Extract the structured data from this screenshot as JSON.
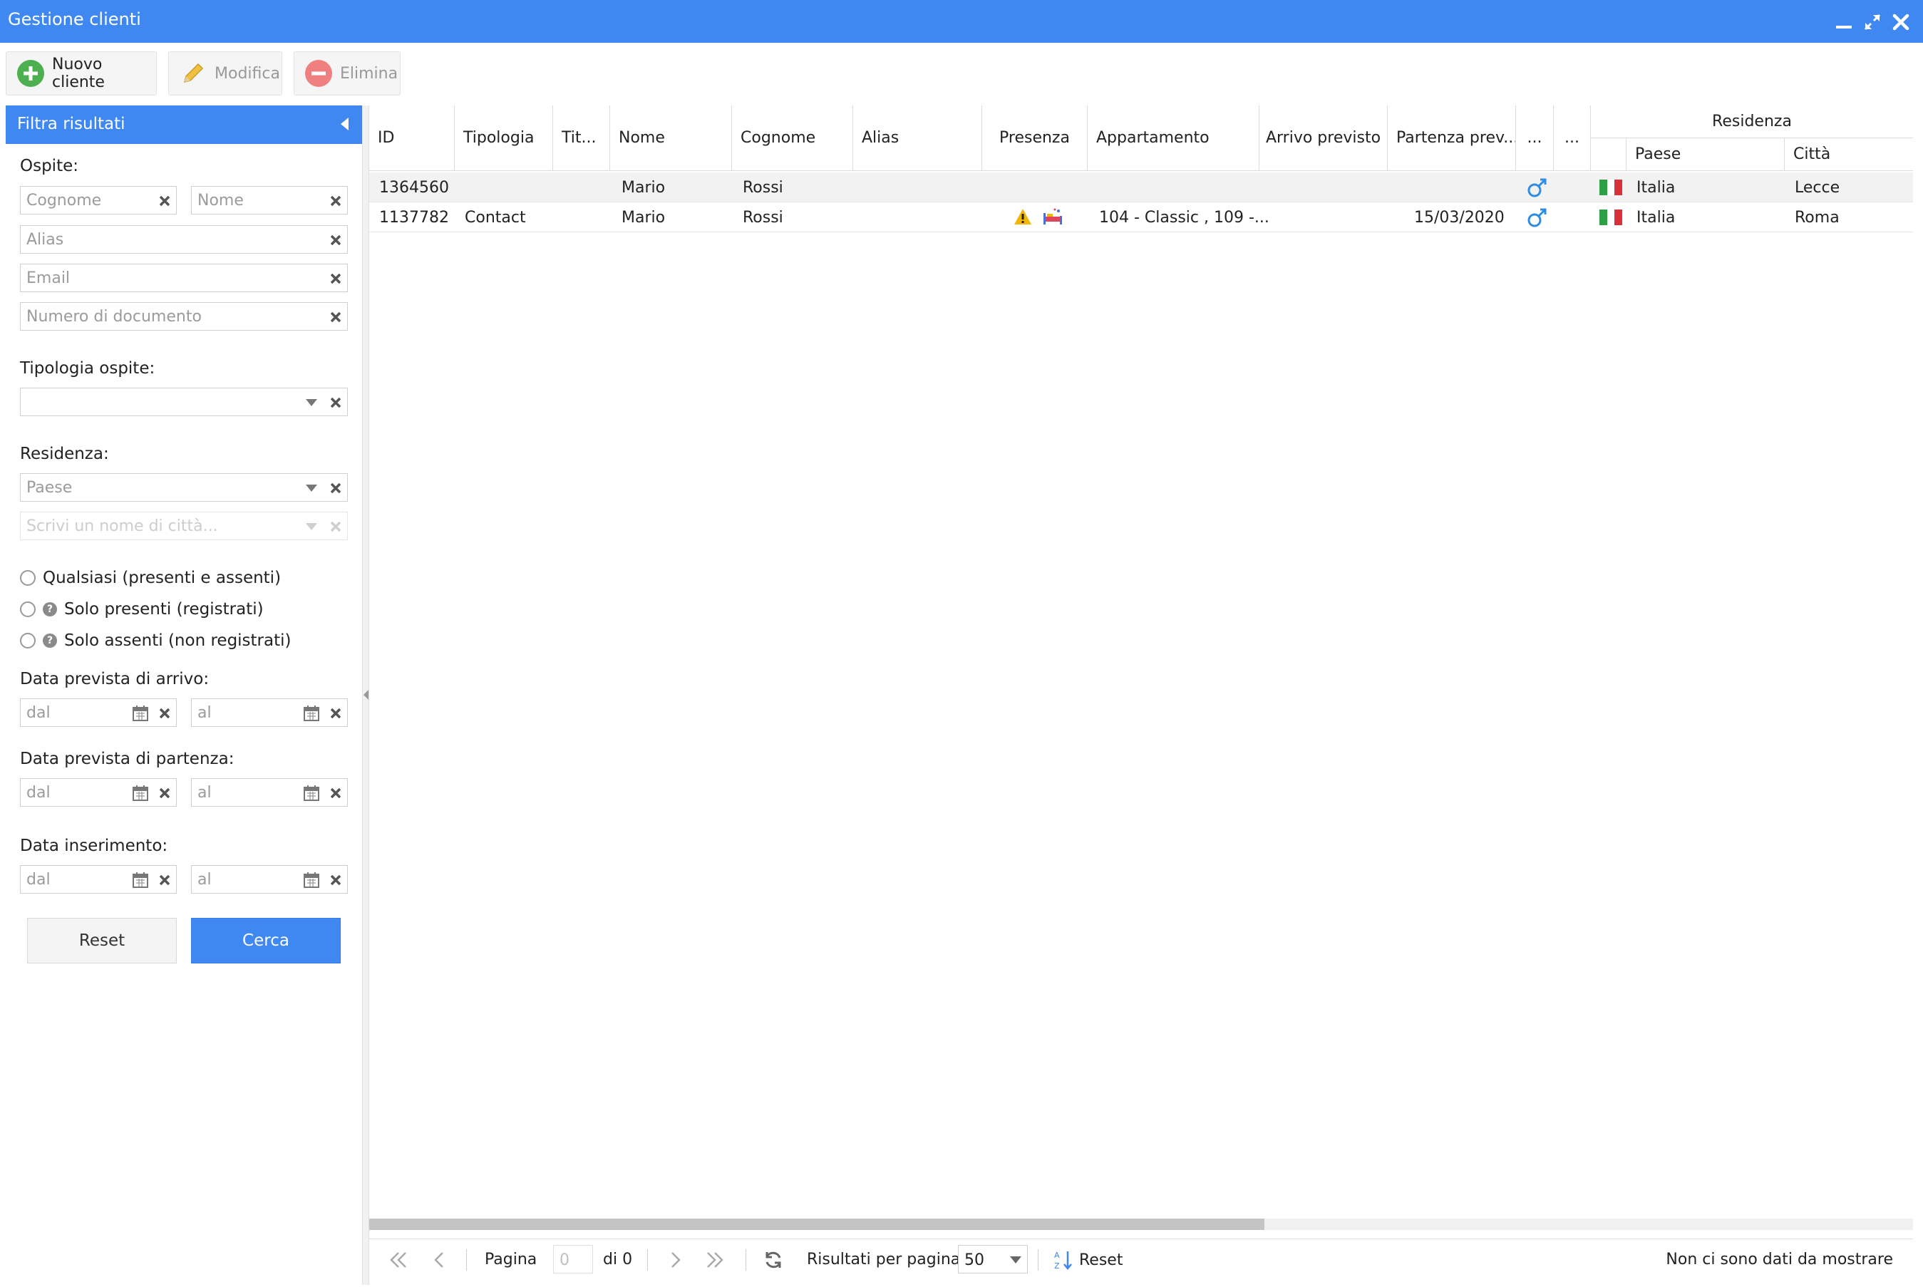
{
  "window": {
    "title": "Gestione clienti"
  },
  "toolbar": {
    "new_label": "Nuovo cliente",
    "edit_label": "Modifica",
    "delete_label": "Elimina"
  },
  "filter": {
    "header": "Filtra risultati",
    "guest_label": "Ospite:",
    "surname_placeholder": "Cognome",
    "name_placeholder": "Nome",
    "alias_placeholder": "Alias",
    "email_placeholder": "Email",
    "document_placeholder": "Numero di documento",
    "type_label": "Tipologia ospite:",
    "residence_label": "Residenza:",
    "country_placeholder": "Paese",
    "city_placeholder": "Scrivi un nome di città...",
    "presence_options": [
      "Qualsiasi (presenti e assenti)",
      "Solo presenti (registrati)",
      "Solo assenti (non registrati)"
    ],
    "help_glyph": "?",
    "arrival_label": "Data prevista di arrivo:",
    "departure_label": "Data prevista di partenza:",
    "insertion_label": "Data inserimento:",
    "from_placeholder": "dal",
    "to_placeholder": "al",
    "reset_label": "Reset",
    "search_label": "Cerca"
  },
  "grid": {
    "columns": {
      "id": "ID",
      "type": "Tipologia",
      "title": "Tit...",
      "name": "Nome",
      "surname": "Cognome",
      "alias": "Alias",
      "presence": "Presenza",
      "apartment": "Appartamento",
      "arrival": "Arrivo previsto",
      "departure": "Partenza prev...",
      "more1": "...",
      "more2": "...",
      "residence": "Residenza",
      "country": "Paese",
      "city": "Città"
    },
    "rows": [
      {
        "id": "1364560",
        "type": "",
        "name": "Mario",
        "surname": "Rossi",
        "apartment": "",
        "departure": "",
        "gender_icon": "male-icon",
        "flag": "italy",
        "country": "Italia",
        "city": "Lecce"
      },
      {
        "id": "1137782",
        "type": "Contact",
        "name": "Mario",
        "surname": "Rossi",
        "apartment": "104 - Classic , 109 -...",
        "departure": "15/03/2020",
        "gender_icon": "male-icon",
        "flag": "italy",
        "country": "Italia",
        "city": "Roma"
      }
    ]
  },
  "pager": {
    "page_label": "Pagina",
    "page_value": "0",
    "of_label": "di 0",
    "per_page_label": "Risultati per pagina",
    "per_page_value": "50",
    "reset_label": "Reset",
    "empty_message": "Non ci sono dati da mostrare"
  },
  "colors": {
    "accent": "#3f88f2",
    "add_green": "#4caf50",
    "delete_red": "#f08080",
    "edit_yellow": "#f0c040",
    "male_blue": "#2f8de0",
    "italy_green": "#2e9e47",
    "italy_red": "#d8313b",
    "warning": "#f2b705"
  }
}
